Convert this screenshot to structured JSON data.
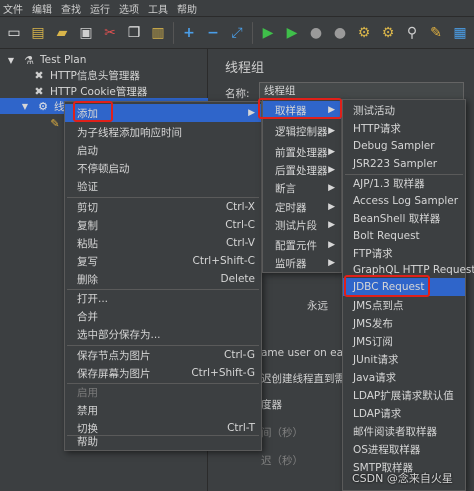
{
  "menubar": [
    "文件",
    "编辑",
    "查找",
    "运行",
    "选项",
    "工具",
    "帮助"
  ],
  "tree": {
    "root": "Test Plan",
    "items": [
      "HTTP信息头管理器",
      "HTTP Cookie管理器",
      "线程组"
    ]
  },
  "right_pane": {
    "title": "线程组",
    "name_label": "名称:",
    "name_value": "线程组",
    "fragments": [
      "永远",
      "ame user on each",
      "迟创建线程直到需",
      "度器",
      "间（秒）",
      "迟（秒）"
    ]
  },
  "context_menu": {
    "items": [
      {
        "label": "添加",
        "shortcut": "",
        "submenu": true
      },
      {
        "label": "为子线程添加响应时间",
        "shortcut": ""
      },
      {
        "label": "启动",
        "shortcut": ""
      },
      {
        "label": "不停顿启动",
        "shortcut": ""
      },
      {
        "label": "验证",
        "shortcut": ""
      },
      {
        "label": "剪切",
        "shortcut": "Ctrl-X"
      },
      {
        "label": "复制",
        "shortcut": "Ctrl-C"
      },
      {
        "label": "粘贴",
        "shortcut": "Ctrl-V"
      },
      {
        "label": "复写",
        "shortcut": "Ctrl+Shift-C"
      },
      {
        "label": "删除",
        "shortcut": "Delete"
      },
      {
        "label": "打开...",
        "shortcut": ""
      },
      {
        "label": "合并",
        "shortcut": ""
      },
      {
        "label": "选中部分保存为...",
        "shortcut": ""
      },
      {
        "label": "保存节点为图片",
        "shortcut": "Ctrl-G"
      },
      {
        "label": "保存屏幕为图片",
        "shortcut": "Ctrl+Shift-G"
      },
      {
        "label": "启用",
        "shortcut": ""
      },
      {
        "label": "禁用",
        "shortcut": ""
      },
      {
        "label": "切换",
        "shortcut": "Ctrl-T"
      },
      {
        "label": "帮助",
        "shortcut": ""
      }
    ]
  },
  "add_submenu": {
    "items": [
      "取样器",
      "逻辑控制器",
      "前置处理器",
      "后置处理器",
      "断言",
      "定时器",
      "测试片段",
      "配置元件",
      "监听器"
    ]
  },
  "sampler_submenu": {
    "items": [
      "测试活动",
      "HTTP请求",
      "Debug Sampler",
      "JSR223 Sampler",
      "AJP/1.3 取样器",
      "Access Log Sampler",
      "BeanShell 取样器",
      "Bolt Request",
      "FTP请求",
      "GraphQL HTTP Request",
      "JDBC Request",
      "JMS点到点",
      "JMS发布",
      "JMS订阅",
      "JUnit请求",
      "Java请求",
      "LDAP扩展请求默认值",
      "LDAP请求",
      "邮件阅读者取样器",
      "OS进程取样器",
      "SMTP取样器"
    ]
  },
  "watermark": "CSDN @念来自火星",
  "colors": {
    "highlight": "#2f65ca",
    "annotation": "#e0201a",
    "background": "#3c3f41"
  }
}
